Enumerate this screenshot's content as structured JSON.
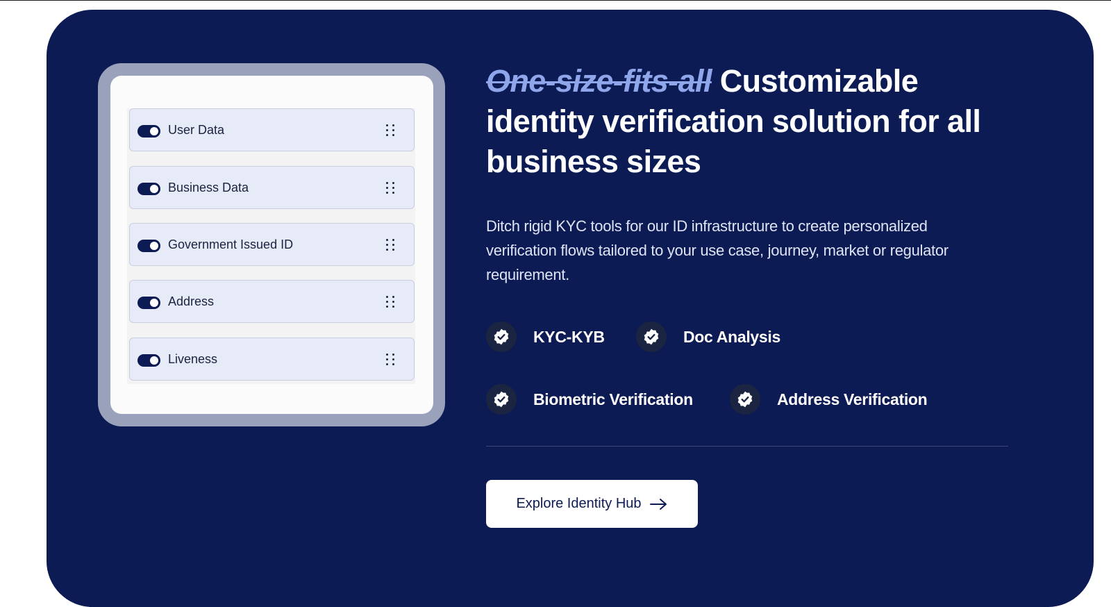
{
  "hero": {
    "headline_strike": "One-size-fits-all",
    "headline_rest": "Customizable identity verification solution for all business sizes",
    "description": "Ditch rigid KYC tools for our ID infrastructure to create personalized verification flows tailored to your use case, journey, market or regulator requirement.",
    "features": [
      {
        "label": "KYC-KYB",
        "icon": "verified-badge-icon"
      },
      {
        "label": "Doc Analysis",
        "icon": "verified-badge-icon"
      },
      {
        "label": "Biometric Verification",
        "icon": "verified-badge-icon"
      },
      {
        "label": "Address Verification",
        "icon": "verified-badge-icon"
      }
    ],
    "cta_label": "Explore Identity Hub"
  },
  "flow_card": {
    "items": [
      {
        "label": "User Data",
        "enabled": true
      },
      {
        "label": "Business Data",
        "enabled": true
      },
      {
        "label": "Government Issued ID",
        "enabled": true
      },
      {
        "label": "Address",
        "enabled": true
      },
      {
        "label": "Liveness",
        "enabled": true
      }
    ]
  },
  "colors": {
    "panel": "#0d1b54",
    "strike_text": "#8fa6ea",
    "row_bg": "#e7eaf7",
    "frame": "#9aa2bb"
  }
}
